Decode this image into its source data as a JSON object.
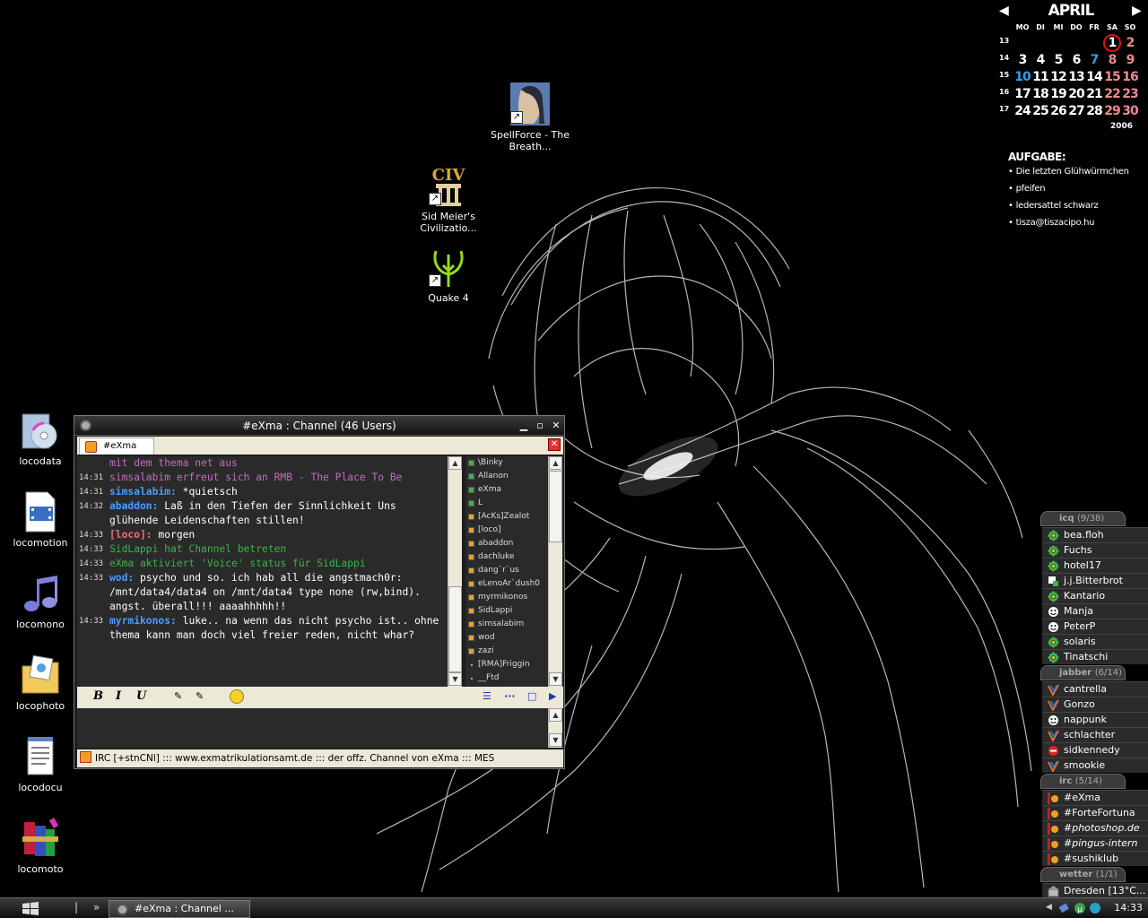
{
  "desktop": {
    "top_icons": [
      {
        "label": "SpellForce - The Breath...",
        "icon": "spellforce-icon"
      },
      {
        "label": "Sid Meier's Civilizatio...",
        "icon": "civilization-icon"
      },
      {
        "label": "Quake 4",
        "icon": "quake-icon"
      }
    ],
    "left_icons": [
      {
        "label": "locodata",
        "icon": "cd-folder-icon"
      },
      {
        "label": "locomotion",
        "icon": "video-file-icon"
      },
      {
        "label": "locomono",
        "icon": "music-note-icon"
      },
      {
        "label": "locophoto",
        "icon": "photo-folder-icon"
      },
      {
        "label": "locodocu",
        "icon": "notepad-icon"
      },
      {
        "label": "locomoto",
        "icon": "winrar-icon"
      }
    ]
  },
  "calendar": {
    "month": "APRIL",
    "year": "2006",
    "weekdays": [
      "MO",
      "DI",
      "MI",
      "DO",
      "FR",
      "SA",
      "SO"
    ],
    "weeks": [
      {
        "week": "13",
        "days": [
          "",
          "",
          "",
          "",
          "",
          "1",
          "2"
        ]
      },
      {
        "week": "14",
        "days": [
          "3",
          "4",
          "5",
          "6",
          "7",
          "8",
          "9"
        ]
      },
      {
        "week": "15",
        "days": [
          "10",
          "11",
          "12",
          "13",
          "14",
          "15",
          "16"
        ]
      },
      {
        "week": "16",
        "days": [
          "17",
          "18",
          "19",
          "20",
          "21",
          "22",
          "23"
        ]
      },
      {
        "week": "17",
        "days": [
          "24",
          "25",
          "26",
          "27",
          "28",
          "29",
          "30"
        ]
      }
    ],
    "today": "1",
    "highlight_blue": [
      "7",
      "10"
    ],
    "colors": {
      "weekend": "#f08a8a",
      "highlight": "#2aa0e8",
      "today_ring": "#e01010"
    }
  },
  "tasks": {
    "title": "AUFGABE:",
    "items": [
      "Die letzten Glühwürmchen",
      "pfeifen",
      "ledersattel schwarz",
      "tisza@tiszacipo.hu"
    ]
  },
  "irc": {
    "title": "#eXma : Channel (46 Users)",
    "tab": "#eXma",
    "messages": [
      {
        "ts": "",
        "nick": "",
        "text": "mit dem thema net aus",
        "color": "#c070c0"
      },
      {
        "ts": "14:31",
        "nick": "",
        "text": "simsalabim erfreut sich an RMB - The Place To Be",
        "color": "#c070c0"
      },
      {
        "ts": "14:31",
        "nick": "simsalabim:",
        "nick_color": "#4a9cff",
        "text": "*quietsch",
        "color": "#ffffff"
      },
      {
        "ts": "14:32",
        "nick": "abaddon:",
        "nick_color": "#4a9cff",
        "text": "Laß in den Tiefen der Sinnlichkeit Uns glühende Leidenschaften stillen!",
        "color": "#ffffff"
      },
      {
        "ts": "14:33",
        "nick": "[loco]:",
        "nick_color": "#f07070",
        "text": "morgen",
        "color": "#ffffff"
      },
      {
        "ts": "14:33",
        "nick": "",
        "text": "SidLappi hat Channel betreten",
        "color": "#3cb44a"
      },
      {
        "ts": "14:33",
        "nick": "",
        "text": "eXma aktiviert 'Voice' status für SidLappi",
        "color": "#3cb44a"
      },
      {
        "ts": "14:33",
        "nick": "wod:",
        "nick_color": "#4a9cff",
        "text": "psycho und so. ich hab all die angstmach0r: /mnt/data4/data4 on /mnt/data4 type none (rw,bind). angst. überall!!! aaaahhhhh!!",
        "color": "#ffffff"
      },
      {
        "ts": "14:33",
        "nick": "myrmikonos:",
        "nick_color": "#4a9cff",
        "text": "luke.. na wenn das nicht psycho ist.. ohne thema kann man doch viel freier reden, nicht whar?",
        "color": "#ffffff"
      }
    ],
    "users": [
      {
        "name": "\\Binky",
        "mark": "#3cb44a"
      },
      {
        "name": "Allanon",
        "mark": "#3cb44a"
      },
      {
        "name": "eXma",
        "mark": "#3cb44a"
      },
      {
        "name": "L",
        "mark": "#3cb44a"
      },
      {
        "name": "[AcKs]Zealot",
        "mark": "#f0a020"
      },
      {
        "name": "[loco]",
        "mark": "#f0a020"
      },
      {
        "name": "abaddon",
        "mark": "#f0a020"
      },
      {
        "name": "dachluke",
        "mark": "#f0a020"
      },
      {
        "name": "dang`r`us",
        "mark": "#f0a020"
      },
      {
        "name": "eLenoAr`dush0",
        "mark": "#f0a020"
      },
      {
        "name": "myrmikonos",
        "mark": "#f0a020"
      },
      {
        "name": "SidLappi",
        "mark": "#f0a020"
      },
      {
        "name": "simsalabim",
        "mark": "#f0a020"
      },
      {
        "name": "wod",
        "mark": "#f0a020"
      },
      {
        "name": "zazi",
        "mark": "#f0a020"
      },
      {
        "name": "[RMA]Friggin",
        "mark": "dot"
      },
      {
        "name": "__Ftd",
        "mark": "dot"
      }
    ],
    "toolbar": {
      "bold": "B",
      "italic": "I",
      "underline": "U"
    },
    "input_value": "",
    "status": "IRC   [+stnCNl] ::: www.exmatrikulationsamt.de ::: der offz. Channel von eXma ::: MES"
  },
  "contacts": {
    "groups": [
      {
        "name": "icq",
        "count": "(9/38)",
        "contacts": [
          {
            "name": "bea.floh",
            "status": "icq-online-icon"
          },
          {
            "name": "Fuchs",
            "status": "icq-online-icon"
          },
          {
            "name": "hotel17",
            "status": "icq-online-icon"
          },
          {
            "name": "j.j.Bitterbrot",
            "status": "icq-away-icon"
          },
          {
            "name": "Kantario",
            "status": "icq-online-icon"
          },
          {
            "name": "Manja",
            "status": "icq-ffc-icon"
          },
          {
            "name": "PeterP",
            "status": "icq-ffc-icon"
          },
          {
            "name": "solaris",
            "status": "icq-online-icon"
          },
          {
            "name": "Tinatschi",
            "status": "icq-online-icon"
          }
        ]
      },
      {
        "name": "jabber",
        "count": "(6/14)",
        "contacts": [
          {
            "name": "cantrella",
            "status": "jabber-online-icon"
          },
          {
            "name": "Gonzo",
            "status": "jabber-online-icon"
          },
          {
            "name": "nappunk",
            "status": "jabber-ffc-icon"
          },
          {
            "name": "schlachter",
            "status": "jabber-online-icon"
          },
          {
            "name": "sidkennedy",
            "status": "jabber-dnd-icon"
          },
          {
            "name": "smookie",
            "status": "jabber-online-icon"
          }
        ]
      },
      {
        "name": "irc",
        "count": "(5/14)",
        "contacts": [
          {
            "name": "#eXma",
            "status": "irc-channel-icon"
          },
          {
            "name": "#ForteFortuna",
            "status": "irc-channel-icon"
          },
          {
            "name": "#photoshop.de",
            "status": "irc-channel-icon"
          },
          {
            "name": "#pingus-intern",
            "status": "irc-channel-icon"
          },
          {
            "name": "#sushiklub",
            "status": "irc-channel-icon"
          }
        ]
      },
      {
        "name": "wetter",
        "count": "(1/1)",
        "contacts": [
          {
            "name": "Dresden  [13°C...",
            "status": "weather-icon"
          }
        ]
      }
    ]
  },
  "taskbar": {
    "task_label": "#eXma : Channel ...",
    "clock": "14:33",
    "quicklaunch": [
      "|",
      "»"
    ]
  }
}
